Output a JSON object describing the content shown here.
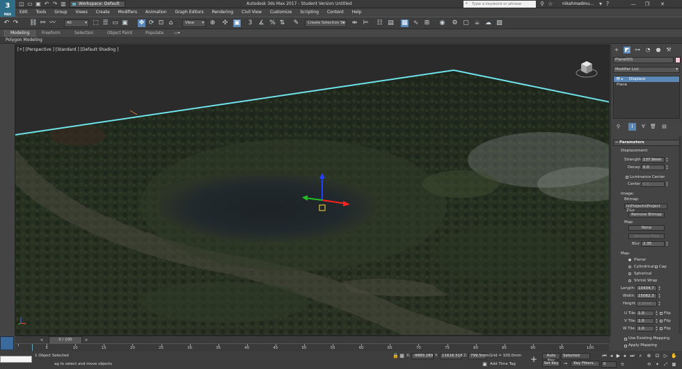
{
  "app": {
    "logo": "3",
    "logo_sub": "MAX",
    "title": "Autodesk 3ds Max 2017 - Student Version    Untitled",
    "workspace": "Workspace: Default",
    "search_placeholder": "Type a keyword or phrase",
    "user": "nikahmadmu..."
  },
  "menu": [
    "Edit",
    "Tools",
    "Group",
    "Views",
    "Create",
    "Modifiers",
    "Animation",
    "Graph Editors",
    "Rendering",
    "Civil View",
    "Customize",
    "Scripting",
    "Content",
    "Help"
  ],
  "toolbar": {
    "selection_filter": "All",
    "ref_coord": "View",
    "named_selection": "Create Selection Se"
  },
  "ribbon": {
    "tabs": [
      "Modeling",
      "Freeform",
      "Selection",
      "Object Paint",
      "Populate"
    ],
    "sublabel": "Polygon Modeling"
  },
  "viewport": {
    "label": "[+] [Perspective ] [Standard ] [Default Shading ]"
  },
  "command_panel": {
    "object_name": "Plane001",
    "object_color": "#f4c6d8",
    "modifier_list": "Modifier List",
    "stack": [
      "Displace",
      "Plane"
    ],
    "rollout": "Parameters",
    "displacement_label": "Displacement:",
    "strength_label": "Strength:",
    "strength": "137.9mm",
    "decay_label": "Decay:",
    "decay": "0.0",
    "luminance_center": "Luminance Center",
    "center_label": "Center:",
    "center": "0.5",
    "image_label": "Image:",
    "bitmap_label": "Bitmap:",
    "bitmap": "ls\\Projects\\Project 2\\Lo",
    "remove_bitmap": "Remove Bitmap",
    "map_label": "Map:",
    "map_none": "None",
    "remove_map": "Remove Map",
    "blur_label": "Blur:",
    "blur": "2.35",
    "mapping_label": "Map:",
    "planar": "Planar",
    "cylindrical": "Cylindrical",
    "cap": "Cap",
    "spherical": "Spherical",
    "shrink_wrap": "Shrink Wrap",
    "length_label": "Length:",
    "length": "10434.7",
    "width_label": "Width:",
    "width": "15082.3",
    "height_label": "Height:",
    "height": "1.0mm",
    "utile_label": "U Tile:",
    "utile": "1.0",
    "vtile_label": "V Tile:",
    "vtile": "1.0",
    "wtile_label": "W Tile:",
    "wtile": "1.0",
    "flip": "Flip",
    "use_existing": "Use Existing Mapping",
    "apply_mapping": "Apply Mapping"
  },
  "timeline": {
    "slider": "0 / 100",
    "ticks": [
      "0",
      "5",
      "10",
      "15",
      "20",
      "25",
      "30",
      "35",
      "40",
      "45",
      "50",
      "55",
      "60",
      "65",
      "70",
      "75",
      "80",
      "85",
      "90",
      "95",
      "100"
    ]
  },
  "status": {
    "selected": "1 Object Selected",
    "prompt": "ag to select and move objects",
    "x_label": "X:",
    "x": "-9889.289",
    "y_label": "Y:",
    "y": "11616.518",
    "z_label": "Z:",
    "z": "799.5mm",
    "grid": "Grid = 100.0mm",
    "add_time_tag": "Add Time Tag",
    "auto_key": "Auto Key",
    "set_key": "Set Key",
    "selected_dropdown": "Selected",
    "key_filters": "Key Filters...",
    "frame": "0"
  }
}
